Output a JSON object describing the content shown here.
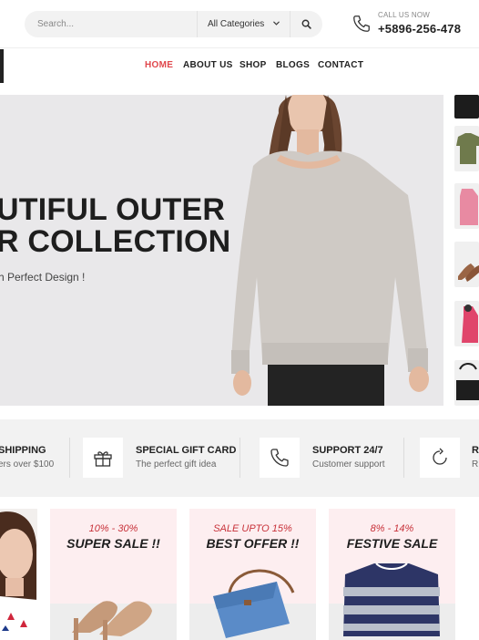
{
  "header": {
    "search": {
      "placeholder": "Search..."
    },
    "category": {
      "selected": "All Categories"
    },
    "contact": {
      "label": "CALL US NOW",
      "number": "+5896-256-478"
    }
  },
  "nav": {
    "items": [
      "HOME",
      "ABOUT US",
      "SHOP",
      "BLOGS",
      "CONTACT"
    ],
    "active": "HOME"
  },
  "hero": {
    "title_line1": "UTIFUL OUTER",
    "title_line2": "R COLLECTION",
    "subtitle": "h Perfect Design !"
  },
  "services": [
    {
      "title": "SHIPPING",
      "subtitle": "ers over $100",
      "icon": "truck-icon"
    },
    {
      "title": "SPECIAL GIFT CARD",
      "subtitle": "The perfect gift idea",
      "icon": "gift-icon"
    },
    {
      "title": "SUPPORT 24/7",
      "subtitle": "Customer support",
      "icon": "phone-icon"
    },
    {
      "title": "R",
      "subtitle": "R",
      "icon": "refresh-icon"
    }
  ],
  "promos": [
    {
      "kicker": "10% - 30%",
      "title": "SUPER SALE !!"
    },
    {
      "kicker": "SALE UPTO 15%",
      "title": "BEST OFFER !!"
    },
    {
      "kicker": "8% - 14%",
      "title": "FESTIVE SALE"
    }
  ],
  "colors": {
    "accent": "#e0474c",
    "hero_bg": "#e9e8ea",
    "promo_bg": "#fdeef0",
    "strip_bg": "#f2f2f2",
    "sale_red": "#c8323a"
  }
}
